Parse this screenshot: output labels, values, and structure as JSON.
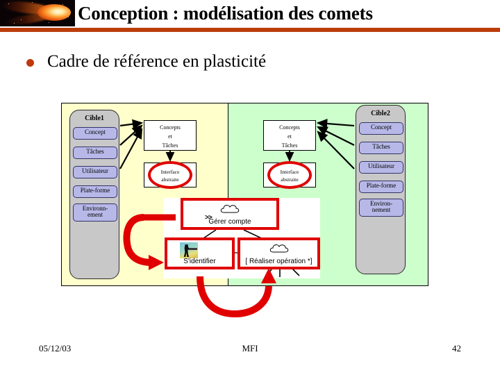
{
  "header": {
    "title": "Conception : modélisation des comets",
    "logo_icon": "comet-icon",
    "rule_color": "#bc3d0c"
  },
  "bullet": {
    "marker_icon": "bullet-dot-icon",
    "text": "Cadre de référence en plasticité",
    "marker_color": "#c0380c"
  },
  "diagram": {
    "panels": [
      {
        "name": "left",
        "color": "#ffffcc"
      },
      {
        "name": "right",
        "color": "#ccffcc"
      }
    ],
    "targets": [
      {
        "title": "Cible1",
        "items": [
          "Concept",
          "Tâches",
          "Utilisateur",
          "Plate-forme",
          "Environn-\nement"
        ],
        "item_lines": [
          [
            "Concept"
          ],
          [
            "Tâches"
          ],
          [
            "Utilisateur"
          ],
          [
            "Plate-forme"
          ],
          [
            "Environn-",
            "ement"
          ]
        ]
      },
      {
        "title": "Cible2",
        "items": [
          "Concept",
          "Tâches",
          "Utilisateur",
          "Plate-forme",
          "Environ-\nnement"
        ],
        "item_lines": [
          [
            "Concept"
          ],
          [
            "Tâches"
          ],
          [
            "Utilisateur"
          ],
          [
            "Plate-forme"
          ],
          [
            "Environ-",
            "nement"
          ]
        ]
      }
    ],
    "concepts_box": {
      "line1": "Concepts",
      "line2": "et",
      "line3": "Tâches"
    },
    "interface_box": {
      "line1": "Interface",
      "line2": "abstraite",
      "highlight_color": "#e00000"
    }
  },
  "usecase": {
    "boxes": [
      {
        "label": "Gérer compte",
        "icon": "cloud-usecase-icon"
      },
      {
        "label": "S'identifier",
        "icon": "actor-login-icon"
      },
      {
        "label": "[ Réaliser opération  *]",
        "icon": "cloud-usecase-icon"
      }
    ],
    "include_arrow": ">>",
    "border_color": "#e00000"
  },
  "footer": {
    "date": "05/12/03",
    "center": "MFI",
    "page": "42"
  }
}
